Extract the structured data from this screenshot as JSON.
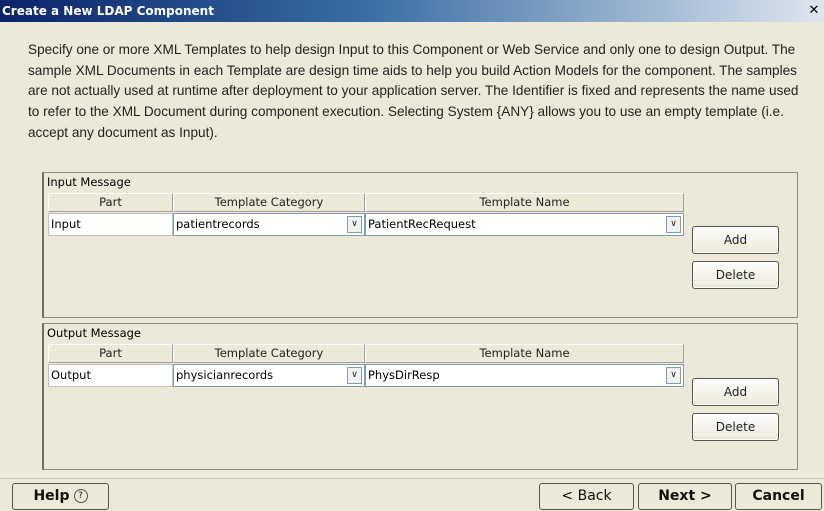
{
  "window": {
    "title": "Create a New LDAP Component",
    "close_glyph": "✕"
  },
  "description": "Specify one or more XML Templates to help design Input to this Component or Web Service and only one to design Output.  The sample XML Documents in each Template are design time aids to help you build Action Models for the component.  The samples are not actually used at runtime after deployment to your application server.  The Identifier is fixed and represents the name used to refer to the XML Document during component execution.  Selecting System {ANY} allows you to use an empty template (i.e. accept any document as Input).",
  "columns": [
    "Part",
    "Template Category",
    "Template Name"
  ],
  "input_message": {
    "label": "Input Message",
    "rows": [
      {
        "part": "Input",
        "category": "patientrecords",
        "name": "PatientRecRequest"
      }
    ],
    "add_label": "Add",
    "delete_label": "Delete"
  },
  "output_message": {
    "label": "Output Message",
    "rows": [
      {
        "part": "Output",
        "category": "physicianrecords",
        "name": "PhysDirResp"
      }
    ],
    "add_label": "Add",
    "delete_label": "Delete"
  },
  "footer": {
    "help_label": "Help",
    "help_icon": "?",
    "back_label": "< Back",
    "next_label": "Next >",
    "cancel_label": "Cancel"
  },
  "icons": {
    "dropdown": "chevron-down-icon",
    "help": "help-circle-icon",
    "close": "close-icon"
  }
}
